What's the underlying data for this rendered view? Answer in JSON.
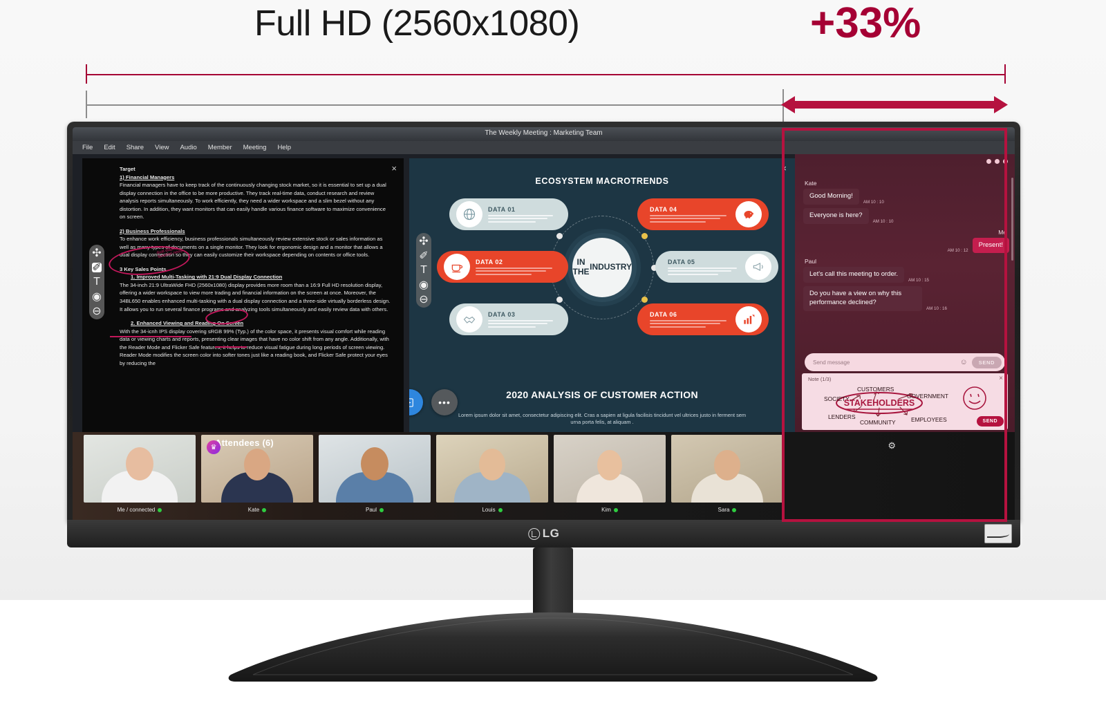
{
  "headline": {
    "title": "Full HD (2560x1080)",
    "percent_badge": "+33%",
    "accent_color": "#a50034"
  },
  "monitor": {
    "brand": "LG",
    "energy_badge_label": "",
    "bezel_color": "#2e2e2e"
  },
  "app": {
    "window_title": "The Weekly Meeting : Marketing Team",
    "menu": [
      "File",
      "Edit",
      "Share",
      "View",
      "Audio",
      "Member",
      "Meeting",
      "Help"
    ],
    "close_icon": "×"
  },
  "document_pane": {
    "close_icon": "×",
    "heading": "Target",
    "section1_title": "1) Financial Managers",
    "section1_body": "Financial managers have to keep track of the continuously changing stock market, so it is essential to set up a dual display connection in the office to be more productive. They track real-time data, conduct research and review analysis reports simultaneously. To work efficiently, they need a wider workspace and a slim bezel without any distortion. In addition, they want monitors that can easily handle various finance software to maximize convenience on screen.",
    "section2_title": "2) Business Professionals",
    "section2_body": "To enhance work efficiency, business professionals simultaneously review extensive stock or sales information as well as many types of documents on a single monitor. They look for ergonomic design and a monitor that allows a dual display connection so they can easily customize their workspace depending on contents or office tools.",
    "sales_heading": "3 Key Sales Points",
    "point1_title": "1.   Improved Multi-Tasking with 21:9 Dual Display Connection",
    "point1_body": "The 34-inch 21:9 UltraWide FHD (2560x1080) display provides more room than a 16:9 Full HD resolution display, offering a wider workspace to view more trading and financial information on the screen at once. Moreover, the 34BL650 enables enhanced multi-tasking with a dual display connection and a three-side virtually borderless design. It allows you to run several finance programs and analyzing tools simultaneously and easily review data with others.",
    "point2_title": "2.   Enhanced Viewing and Reading On Screen",
    "point2_body": "With the 34-icnh IPS display covering sRGB 99% (Typ.) of the color space, it presents visual comfort while reading data or viewing charts and reports, presenting clear images that have no color shift from any angle. Additionally, with the Reader Mode and Flicker Safe features, it helps to reduce visual fatigue during long periods of screen viewing. Reader Mode modifies the screen color into softer tones just like a reading book, and  Flicker Safe protect your eyes by reducing the",
    "tools": [
      {
        "name": "move-tool",
        "glyph": "✣"
      },
      {
        "name": "pen-tool",
        "glyph": "✐"
      },
      {
        "name": "text-tool",
        "glyph": "T"
      },
      {
        "name": "shape-tool",
        "glyph": "◉"
      },
      {
        "name": "erase-tool",
        "glyph": "⊖"
      }
    ]
  },
  "presentation_pane": {
    "close_icon": "×",
    "title": "ECOSYSTEM MACROTRENDS",
    "hub_line1": "IN THE",
    "hub_line2": "INDUSTRY",
    "footer_title": "2020 ANALYSIS OF CUSTOMER ACTION",
    "footer_body": "Lorem ipsum dolor sit amet, consectetur adipiscing elit. Cras a sapien at ligula facilisis tincidunt vel ultrices justo in ferment sem urna porta felis, at aliquam .",
    "items": [
      {
        "label": "DATA 01",
        "icon": "globe-icon",
        "glyph": "⊕",
        "style": "light",
        "side": "left"
      },
      {
        "label": "DATA 02",
        "icon": "coffee-icon",
        "glyph": "☕",
        "style": "dark",
        "side": "left"
      },
      {
        "label": "DATA 03",
        "icon": "handshake-icon",
        "glyph": "✋",
        "style": "light",
        "side": "left"
      },
      {
        "label": "DATA 04",
        "icon": "piggybank-icon",
        "glyph": "ὁ6",
        "style": "dark",
        "side": "right"
      },
      {
        "label": "DATA 05",
        "icon": "megaphone-icon",
        "glyph": "὎2",
        "style": "light",
        "side": "right"
      },
      {
        "label": "DATA 06",
        "icon": "chart-icon",
        "glyph": "Ὄ8",
        "style": "dark",
        "side": "right"
      }
    ],
    "call_buttons": [
      {
        "name": "microphone-button",
        "glyph": "Ἲ4",
        "color": "#e02020"
      },
      {
        "name": "camera-button",
        "glyph": "▭",
        "color": "#27ae60"
      },
      {
        "name": "share-screen-button",
        "glyph": "⎙",
        "color": "#2e86de"
      },
      {
        "name": "more-options-button",
        "glyph": "•••",
        "color": "#55595c"
      }
    ],
    "tools": [
      {
        "name": "move-tool",
        "glyph": "✣"
      },
      {
        "name": "pen-tool",
        "glyph": "✐"
      },
      {
        "name": "text-tool",
        "glyph": "T"
      },
      {
        "name": "shape-tool",
        "glyph": "◉"
      },
      {
        "name": "erase-tool",
        "glyph": "⊖"
      }
    ]
  },
  "chat_pane": {
    "messages": [
      {
        "sender": "Kate",
        "text": "Good Morning!",
        "time": "AM 10 : 10",
        "own": false
      },
      {
        "sender": "",
        "text": "Everyone is here?",
        "time": "AM 10 : 10",
        "own": false
      },
      {
        "sender": "Me",
        "text": "Present!",
        "time": "AM 10 : 12",
        "own": true
      },
      {
        "sender": "Paul",
        "text": "Let's call this meeting to order.",
        "time": "AM 10 : 15",
        "own": false
      },
      {
        "sender": "",
        "text": "Do you have a view on why this performance  declined?",
        "time": "AM 10 : 16",
        "own": false
      }
    ],
    "input_placeholder": "Send message",
    "emoji_icon": "☺",
    "send_label": "SEND",
    "note": {
      "title": "Note (1/3)",
      "close_icon": "×",
      "send_label": "SEND",
      "center_label": "STAKEHOLDERS",
      "labels": [
        "SOCIETY",
        "CUSTOMERS",
        "GOVERNMENT",
        "LENDERS",
        "COMMUNITY",
        "EMPLOYEES"
      ]
    }
  },
  "attendees": {
    "title": "Attendees (6)",
    "settings_icon": "⚙",
    "list": [
      {
        "name": "Me / connected",
        "status": "online",
        "host": false,
        "skin": "#e7bda0",
        "hair": "#3a2418",
        "shirt": "#f0f0f0",
        "bg": "#d8dcd8"
      },
      {
        "name": "Kate",
        "status": "online",
        "host": true,
        "skin": "#d9a783",
        "hair": "#241611",
        "shirt": "#2b3550",
        "bg": "#cdbca9"
      },
      {
        "name": "Paul",
        "status": "online",
        "host": false,
        "skin": "#c68c5f",
        "hair": "#1d1410",
        "shirt": "#5a7fa8",
        "bg": "#cfd6d9"
      },
      {
        "name": "Louis",
        "status": "online",
        "host": false,
        "skin": "#e3bb97",
        "hair": "#332016",
        "shirt": "#9fb4c6",
        "bg": "#d3c6ae"
      },
      {
        "name": "Kim",
        "status": "online",
        "host": false,
        "skin": "#e8c09e",
        "hair": "#1c1310",
        "shirt": "#efe6dc",
        "bg": "#cfc8bd"
      },
      {
        "name": "Sara",
        "status": "online",
        "host": false,
        "skin": "#ddb08c",
        "hair": "#3d2a1c",
        "shirt": "#e9e2d6",
        "bg": "#c8bda8"
      }
    ]
  }
}
